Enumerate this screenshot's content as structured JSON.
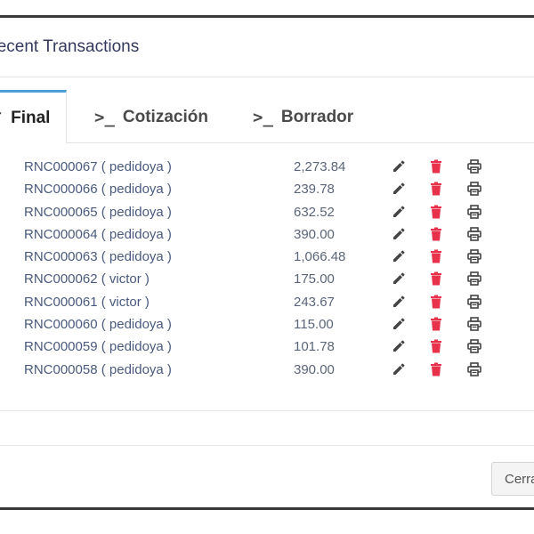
{
  "modal": {
    "title": "Recent Transactions",
    "close_label": "Cerrar"
  },
  "tabs": [
    {
      "label": "Final",
      "icon": "check-icon",
      "active": true
    },
    {
      "label": "Cotización",
      "icon": "terminal-icon",
      "active": false
    },
    {
      "label": "Borrador",
      "icon": "terminal-icon",
      "active": false
    }
  ],
  "transactions": [
    {
      "name": "RNC000067 ( pedidoya )",
      "amount": "2,273.84"
    },
    {
      "name": "RNC000066 ( pedidoya )",
      "amount": "239.78"
    },
    {
      "name": "RNC000065 ( pedidoya )",
      "amount": "632.52"
    },
    {
      "name": "RNC000064 ( pedidoya )",
      "amount": "390.00"
    },
    {
      "name": "RNC000063 ( pedidoya )",
      "amount": "1,066.48"
    },
    {
      "name": "RNC000062 ( victor )",
      "amount": "175.00"
    },
    {
      "name": "RNC000061 ( victor )",
      "amount": "243.67"
    },
    {
      "name": "RNC000060 ( pedidoya )",
      "amount": "115.00"
    },
    {
      "name": "RNC000059 ( pedidoya )",
      "amount": "101.78"
    },
    {
      "name": "RNC000058 ( pedidoya )",
      "amount": "390.00"
    }
  ],
  "row_icons": {
    "edit": "pencil-icon",
    "delete": "trash-icon",
    "print": "printer-icon"
  },
  "colors": {
    "active_tab_accent": "#4a9fd6",
    "delete_icon": "#e8314a",
    "icon_dark": "#444444"
  }
}
